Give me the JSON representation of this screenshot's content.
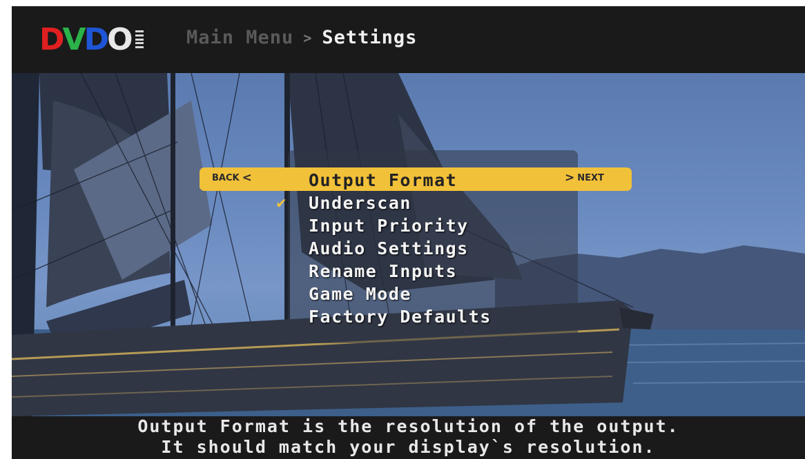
{
  "header": {
    "logo_text": [
      "D",
      "V",
      "D",
      "O"
    ],
    "breadcrumb": {
      "root": "Main Menu",
      "separator": ">",
      "current": "Settings"
    }
  },
  "menu": {
    "back_label": "BACK",
    "next_label": "NEXT",
    "back_arrow": "<",
    "next_arrow": ">",
    "check_glyph": "✔",
    "items": [
      "Output Format",
      "Underscan",
      "Input Priority",
      "Audio Settings",
      "Rename Inputs",
      "Game Mode",
      "Factory Defaults"
    ],
    "selected_index": 0,
    "checked_item": "Underscan"
  },
  "footer": {
    "line1": "Output Format is the resolution of the output.",
    "line2": "It should match your display`s resolution."
  },
  "colors": {
    "highlight": "#f2c13a",
    "logo_d": "#e02020",
    "logo_v": "#2bb34a",
    "logo_d2": "#1f55d6",
    "logo_o": "#e8e8e8",
    "background": "#1a1a1a"
  }
}
